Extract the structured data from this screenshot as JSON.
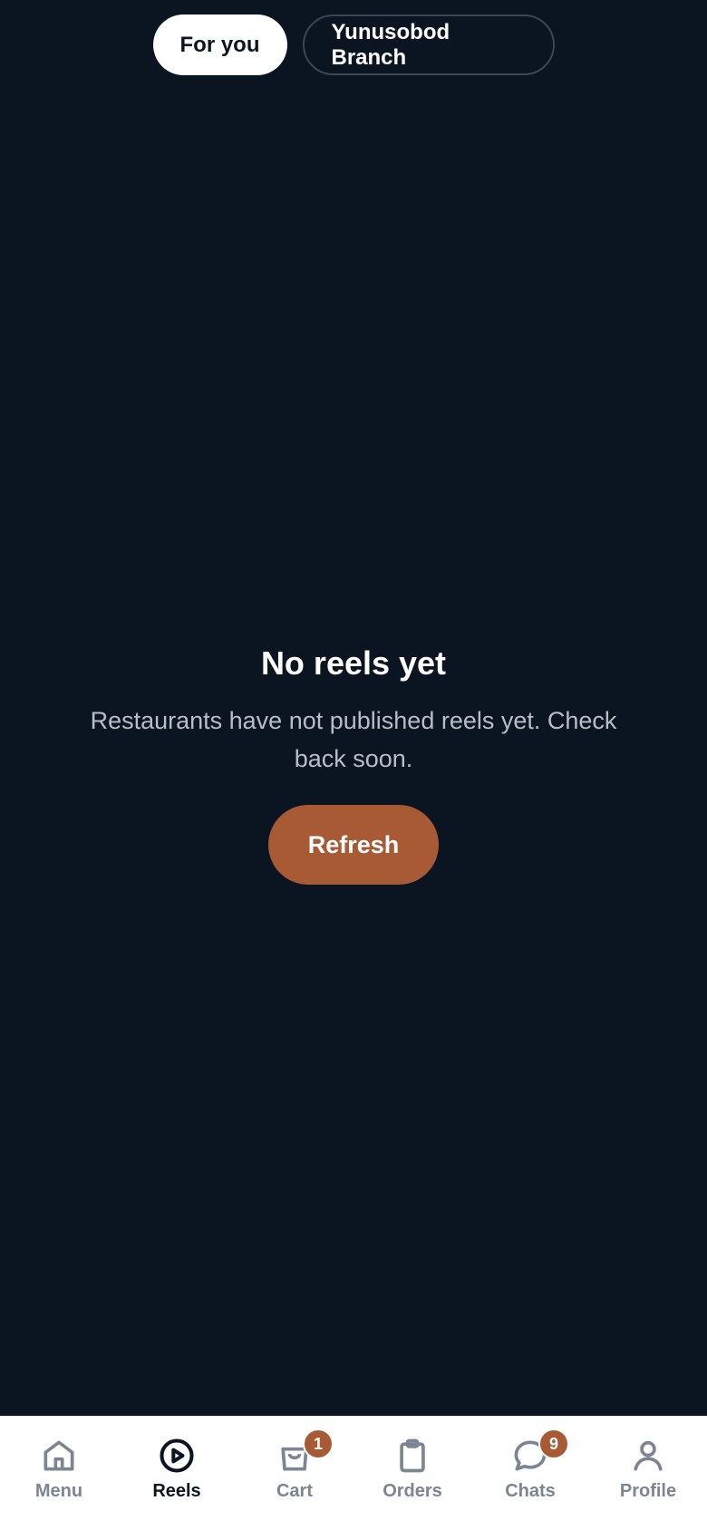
{
  "tabs": [
    {
      "label": "For you",
      "active": true
    },
    {
      "label": "Yunusobod Branch",
      "active": false
    }
  ],
  "empty_state": {
    "title": "No reels yet",
    "message": "Restaurants have not published reels yet. Check back soon.",
    "button_label": "Refresh"
  },
  "nav": {
    "items": [
      {
        "label": "Menu",
        "icon": "home-icon"
      },
      {
        "label": "Reels",
        "icon": "play-circle-icon",
        "active": true
      },
      {
        "label": "Cart",
        "icon": "bag-icon",
        "badge": "1"
      },
      {
        "label": "Orders",
        "icon": "clipboard-icon"
      },
      {
        "label": "Chats",
        "icon": "chat-bubble-icon",
        "badge": "9"
      },
      {
        "label": "Profile",
        "icon": "user-icon"
      }
    ]
  },
  "colors": {
    "background": "#0b1521",
    "accent": "#a85a35",
    "nav_inactive": "#7b8593"
  }
}
